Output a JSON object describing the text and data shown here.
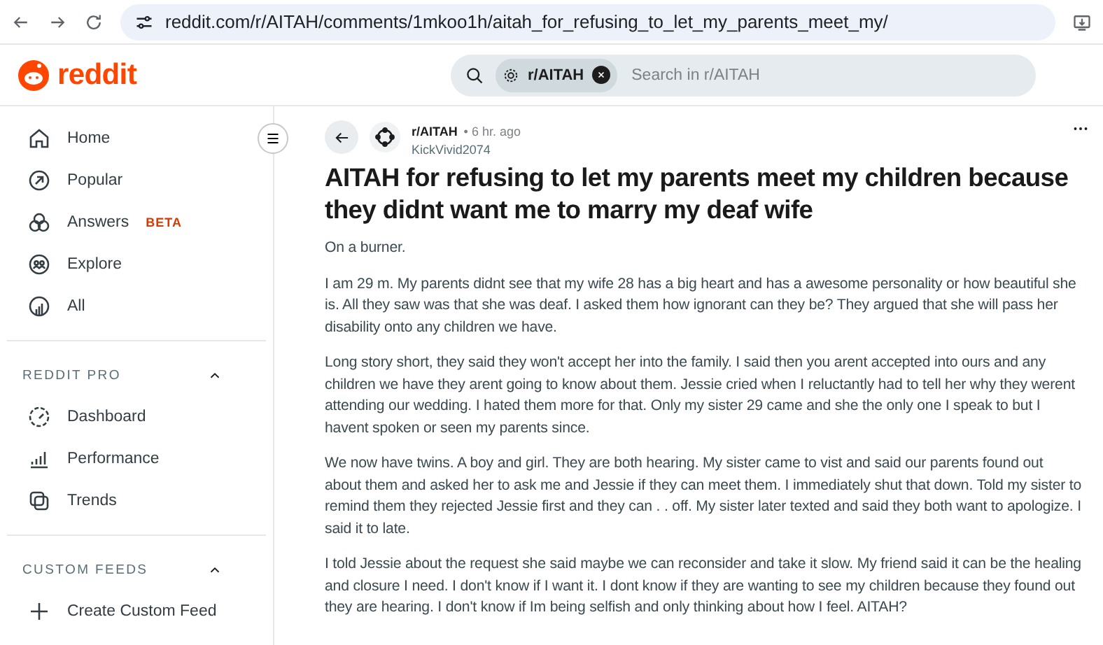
{
  "browser": {
    "url": "reddit.com/r/AITAH/comments/1mkoo1h/aitah_for_refusing_to_let_my_parents_meet_my/"
  },
  "header": {
    "logo": "reddit",
    "search_chip": "r/AITAH",
    "search_placeholder": "Search in r/AITAH"
  },
  "sidebar": {
    "items": [
      {
        "label": "Home"
      },
      {
        "label": "Popular"
      },
      {
        "label": "Answers",
        "badge": "BETA"
      },
      {
        "label": "Explore"
      },
      {
        "label": "All"
      }
    ],
    "sections": [
      {
        "title": "REDDIT PRO",
        "expanded": true,
        "items": [
          {
            "label": "Dashboard"
          },
          {
            "label": "Performance"
          },
          {
            "label": "Trends"
          }
        ]
      },
      {
        "title": "CUSTOM FEEDS",
        "expanded": true,
        "items": [
          {
            "label": "Create Custom Feed"
          }
        ]
      }
    ]
  },
  "post": {
    "subreddit": "r/AITAH",
    "time": "• 6 hr. ago",
    "author": "KickVivid2074",
    "title": "AITAH for refusing to let my parents meet my children because they didnt want me to marry my deaf wife",
    "paragraphs": [
      "On a burner.",
      "I am 29 m. My parents didnt see that my wife 28 has a big heart and has a awesome personality or how beautiful she is. All they saw was that she was deaf. I asked them how ignorant can they be? They argued that she will pass her disability onto any children we have.",
      "Long story short, they said they won't accept her into the family. I said then you arent accepted into ours and any children we have they arent going to know about them. Jessie cried when I reluctantly had to tell her why they werent attending our wedding. I hated them more for that. Only my sister 29 came and she the only one I speak to but I havent spoken or seen my parents since.",
      "We now have twins. A boy and girl. They are both hearing. My sister came to vist and said our parents found out about them and asked her to ask me and Jessie if they can meet them. I immediately shut that down. Told my sister to remind them they rejected Jessie first and they can . . off. My sister later texted and said they both want to apologize. I said it to late.",
      "I told Jessie about the request she said maybe we can reconsider and take it slow. My friend said it can be the healing and closure I need. I don't know if I want it. I dont know if they are wanting to see my children because they found out they are hearing. I don't know if Im being selfish and only thinking about how I feel. AITAH?"
    ]
  }
}
